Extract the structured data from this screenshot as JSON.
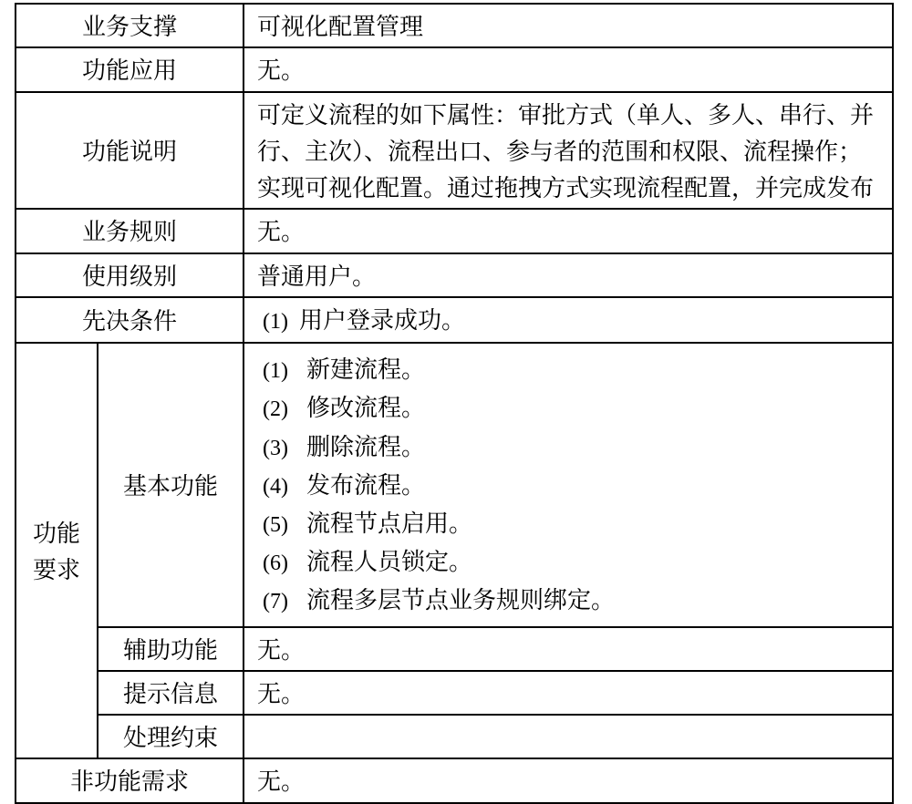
{
  "rows": {
    "biz_support": {
      "label": "业务支撑",
      "value": "可视化配置管理"
    },
    "func_app": {
      "label": "功能应用",
      "value": "无。"
    },
    "func_desc": {
      "label": "功能说明",
      "value": "可定义流程的如下属性：审批方式（单人、多人、串行、并行、主次）、流程出口、参与者的范围和权限、流程操作；实现可视化配置。通过拖拽方式实现流程配置，并完成发布"
    },
    "biz_rule": {
      "label": "业务规则",
      "value": "无。"
    },
    "use_level": {
      "label": "使用级别",
      "value": "普通用户。"
    },
    "prereq": {
      "label": "先决条件",
      "num": "(1)",
      "value": "用户登录成功。"
    },
    "func_req": {
      "label": "功能要求"
    },
    "basic": {
      "label": "基本功能",
      "items": [
        {
          "num": "(1)",
          "txt": "新建流程。"
        },
        {
          "num": "(2)",
          "txt": "修改流程。"
        },
        {
          "num": "(3)",
          "txt": "删除流程。"
        },
        {
          "num": "(4)",
          "txt": "发布流程。"
        },
        {
          "num": "(5)",
          "txt": "流程节点启用。"
        },
        {
          "num": "(6)",
          "txt": "流程人员锁定。"
        },
        {
          "num": "(7)",
          "txt": "流程多层节点业务规则绑定。"
        }
      ]
    },
    "aux_func": {
      "label": "辅助功能",
      "value": "无。"
    },
    "prompt_info": {
      "label": "提示信息",
      "value": "无。"
    },
    "proc_constr": {
      "label": "处理约束",
      "value": ""
    },
    "non_func": {
      "label": "非功能需求",
      "value": "无。"
    }
  }
}
